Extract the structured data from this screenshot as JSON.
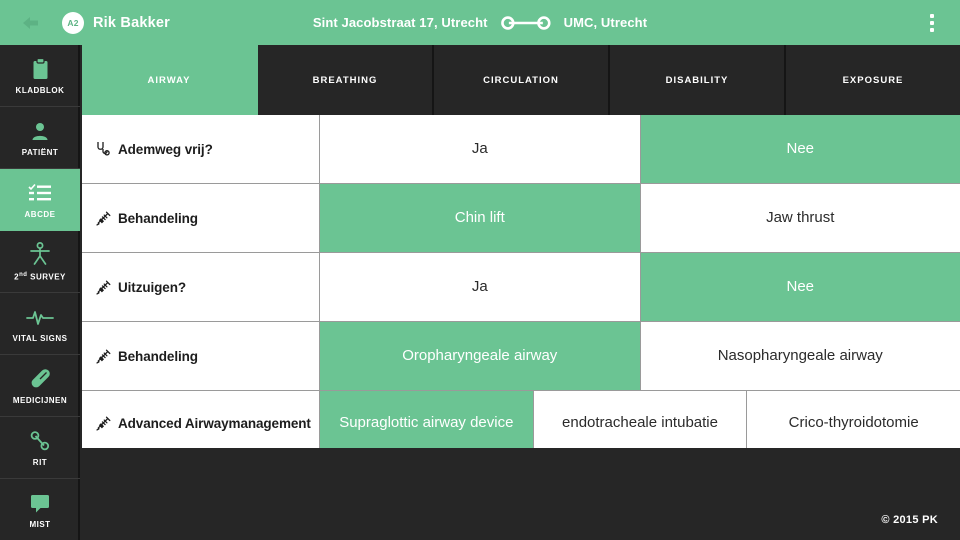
{
  "header": {
    "back_icon": "back-arrow-icon",
    "avatar_label": "A2",
    "patient_name": "Rik Bakker",
    "origin": "Sint Jacobstraat 17, Utrecht",
    "destination": "UMC, Utrecht",
    "route_icon": "route-line-icon",
    "menu_icon": "kebab-menu-icon",
    "accent_color": "#6bc493"
  },
  "sidebar": {
    "items": [
      {
        "label": "KLADBLOK",
        "icon": "clipboard-icon",
        "active": false
      },
      {
        "label": "PATIËNT",
        "icon": "person-icon",
        "active": false
      },
      {
        "label": "ABCDE",
        "icon": "checklist-icon",
        "active": true
      },
      {
        "label": "2ⁿᵈ SURVEY",
        "icon": "body-survey-icon",
        "active": false
      },
      {
        "label": "VITAL SIGNS",
        "icon": "heartbeat-icon",
        "active": false
      },
      {
        "label": "MEDICIJNEN",
        "icon": "pill-icon",
        "active": false
      },
      {
        "label": "RIT",
        "icon": "route-nodes-icon",
        "active": false
      },
      {
        "label": "MIST",
        "icon": "speech-bubble-icon",
        "active": false
      }
    ]
  },
  "tabs": [
    {
      "label": "AIRWAY",
      "active": true
    },
    {
      "label": "BREATHING",
      "active": false
    },
    {
      "label": "CIRCULATION",
      "active": false
    },
    {
      "label": "DISABILITY",
      "active": false
    },
    {
      "label": "EXPOSURE",
      "active": false
    }
  ],
  "rows": [
    {
      "label": "Ademweg vrij?",
      "icon": "stethoscope-icon",
      "options": [
        {
          "text": "Ja",
          "selected": false
        },
        {
          "text": "Nee",
          "selected": true
        }
      ]
    },
    {
      "label": "Behandeling",
      "icon": "syringe-icon",
      "options": [
        {
          "text": "Chin lift",
          "selected": true
        },
        {
          "text": "Jaw thrust",
          "selected": false
        }
      ]
    },
    {
      "label": "Uitzuigen?",
      "icon": "syringe-icon",
      "options": [
        {
          "text": "Ja",
          "selected": false
        },
        {
          "text": "Nee",
          "selected": true
        }
      ]
    },
    {
      "label": "Behandeling",
      "icon": "syringe-icon",
      "options": [
        {
          "text": "Oropharyngeale airway",
          "selected": true
        },
        {
          "text": "Nasopharyngeale airway",
          "selected": false
        }
      ]
    },
    {
      "label": "Advanced Airwaymanagement",
      "icon": "syringe-icon",
      "options": [
        {
          "text": "Supraglottic airway device",
          "selected": true
        },
        {
          "text": "endotracheale intubatie",
          "selected": false
        },
        {
          "text": "Crico-thyroidotomie",
          "selected": false
        }
      ]
    }
  ],
  "footer": {
    "copyright": "© 2015 PK"
  }
}
